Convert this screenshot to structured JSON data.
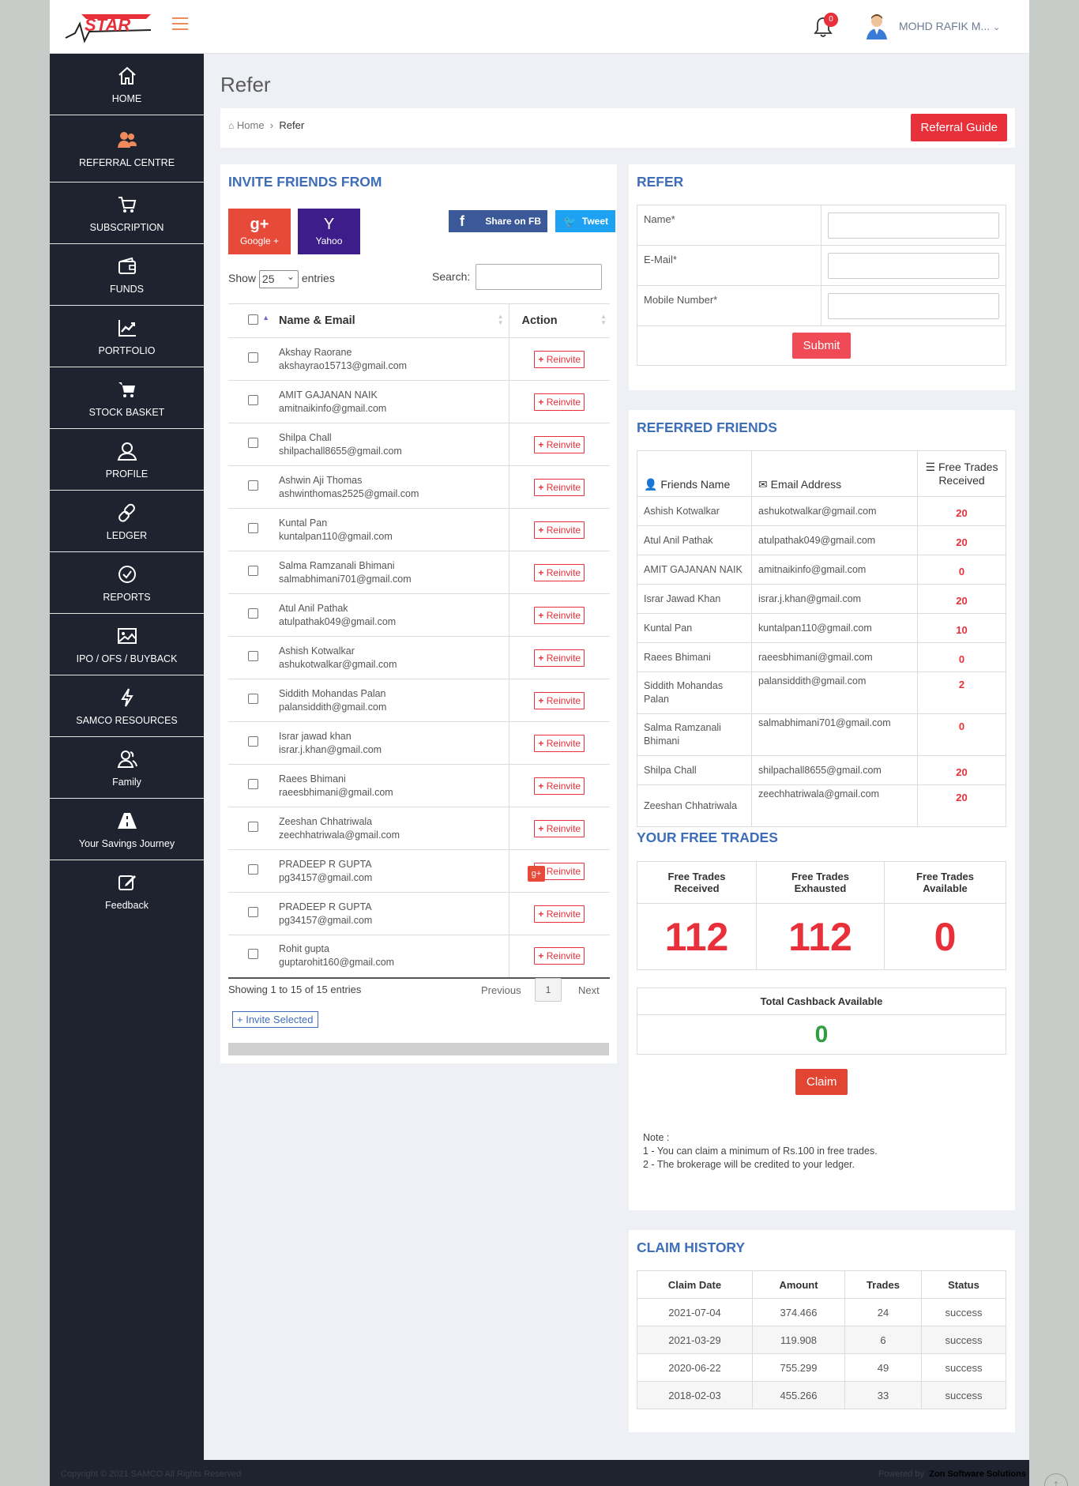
{
  "header": {
    "user_name": "MOHD RAFIK M...",
    "notification_count": "0",
    "logo_text": "STAR"
  },
  "sidebar": {
    "items": [
      {
        "label": "HOME",
        "icon": "home-icon"
      },
      {
        "label": "REFERRAL CENTRE",
        "icon": "referral-icon"
      },
      {
        "label": "SUBSCRIPTION",
        "icon": "cart-icon"
      },
      {
        "label": "FUNDS",
        "icon": "wallet-icon"
      },
      {
        "label": "PORTFOLIO",
        "icon": "chart-line-icon"
      },
      {
        "label": "STOCK BASKET",
        "icon": "basket-icon"
      },
      {
        "label": "PROFILE",
        "icon": "user-icon"
      },
      {
        "label": "LEDGER",
        "icon": "link-icon"
      },
      {
        "label": "REPORTS",
        "icon": "check-circle-icon"
      },
      {
        "label": "IPO / OFS / BUYBACK",
        "icon": "image-icon"
      },
      {
        "label": "SAMCO RESOURCES",
        "icon": "bolt-icon"
      },
      {
        "label": "Family",
        "icon": "users-icon"
      },
      {
        "label": "Your Savings Journey",
        "icon": "road-icon"
      },
      {
        "label": "Feedback",
        "icon": "edit-icon"
      }
    ]
  },
  "page": {
    "title": "Refer",
    "breadcrumb_home": "Home",
    "breadcrumb_current": "Refer",
    "guide_button": "Referral Guide"
  },
  "invite": {
    "title": "INVITE FRIENDS FROM",
    "google_label": "Google +",
    "yahoo_label": "Yahoo",
    "fb_label": "Share on FB",
    "tweet_label": "Tweet",
    "show_label": "Show",
    "entries_value": "25",
    "entries_label": "entries",
    "search_label": "Search:",
    "col_name": "Name & Email",
    "col_action": "Action",
    "reinvite_label": "Reinvite",
    "rows": [
      {
        "name": "Akshay Raorane",
        "email": "akshayrao15713@gmail.com"
      },
      {
        "name": "AMIT GAJANAN NAIK",
        "email": "amitnaikinfo@gmail.com"
      },
      {
        "name": "Shilpa Chall",
        "email": "shilpachall8655@gmail.com"
      },
      {
        "name": "Ashwin Aji Thomas",
        "email": "ashwinthomas2525@gmail.com"
      },
      {
        "name": "Kuntal Pan",
        "email": "kuntalpan110@gmail.com"
      },
      {
        "name": "Salma Ramzanali Bhimani",
        "email": "salmabhimani701@gmail.com"
      },
      {
        "name": "Atul Anil Pathak",
        "email": "atulpathak049@gmail.com"
      },
      {
        "name": "Ashish Kotwalkar",
        "email": "ashukotwalkar@gmail.com"
      },
      {
        "name": "Siddith Mohandas Palan",
        "email": "palansiddith@gmail.com"
      },
      {
        "name": "Israr jawad khan",
        "email": "israr.j.khan@gmail.com"
      },
      {
        "name": "Raees Bhimani",
        "email": "raeesbhimani@gmail.com"
      },
      {
        "name": "Zeeshan Chhatriwala",
        "email": "zeechhatriwala@gmail.com"
      },
      {
        "name": "PRADEEP R GUPTA",
        "email": "pg34157@gmail.com"
      },
      {
        "name": "PRADEEP R GUPTA",
        "email": "pg34157@gmail.com"
      },
      {
        "name": "Rohit gupta",
        "email": "guptarohit160@gmail.com"
      }
    ],
    "showing_text": "Showing 1 to 15 of 15 entries",
    "prev_label": "Previous",
    "page_num": "1",
    "next_label": "Next",
    "invite_selected": "Invite Selected"
  },
  "refer": {
    "title": "REFER",
    "name_label": "Name*",
    "email_label": "E-Mail*",
    "mobile_label": "Mobile Number*",
    "submit_label": "Submit"
  },
  "referred": {
    "title": "REFERRED FRIENDS",
    "col_name": "Friends Name",
    "col_email": "Email Address",
    "col_trades": "Free Trades Received",
    "rows": [
      {
        "name": "Ashish Kotwalkar",
        "email": "ashukotwalkar@gmail.com",
        "trades": "20"
      },
      {
        "name": "Atul Anil Pathak",
        "email": "atulpathak049@gmail.com",
        "trades": "20"
      },
      {
        "name": "AMIT GAJANAN NAIK",
        "email": "amitnaikinfo@gmail.com",
        "trades": "0"
      },
      {
        "name": "Israr Jawad Khan",
        "email": "israr.j.khan@gmail.com",
        "trades": "20"
      },
      {
        "name": "Kuntal Pan",
        "email": "kuntalpan110@gmail.com",
        "trades": "10"
      },
      {
        "name": "Raees Bhimani",
        "email": "raeesbhimani@gmail.com",
        "trades": "0"
      },
      {
        "name": "Siddith Mohandas Palan",
        "email": "palansiddith@gmail.com",
        "trades": "2"
      },
      {
        "name": "Salma Ramzanali Bhimani",
        "email": "salmabhimani701@gmail.com",
        "trades": "0"
      },
      {
        "name": "Shilpa Chall",
        "email": "shilpachall8655@gmail.com",
        "trades": "20"
      },
      {
        "name": "Zeeshan Chhatriwala",
        "email": "zeechhatriwala@gmail.com",
        "trades": "20"
      }
    ]
  },
  "free_trades": {
    "title": "YOUR FREE TRADES",
    "received_label": "Free Trades Received",
    "exhausted_label": "Free Trades Exhausted",
    "available_label": "Free Trades Available",
    "received": "112",
    "exhausted": "112",
    "available": "0",
    "cashback_label": "Total Cashback Available",
    "cashback": "0",
    "claim_label": "Claim",
    "note_title": "Note :",
    "note_1": "1 - You can claim a minimum of Rs.100 in free trades.",
    "note_2": "2 - The brokerage will be credited to your ledger."
  },
  "claim_history": {
    "title": "CLAIM HISTORY",
    "col_date": "Claim Date",
    "col_amount": "Amount",
    "col_trades": "Trades",
    "col_status": "Status",
    "rows": [
      {
        "date": "2021-07-04",
        "amount": "374.466",
        "trades": "24",
        "status": "success"
      },
      {
        "date": "2021-03-29",
        "amount": "119.908",
        "trades": "6",
        "status": "success"
      },
      {
        "date": "2020-06-22",
        "amount": "755.299",
        "trades": "49",
        "status": "success"
      },
      {
        "date": "2018-02-03",
        "amount": "455.266",
        "trades": "33",
        "status": "success"
      }
    ]
  },
  "footer": {
    "copyright": "Copyright © 2021 SAMCO All Rights Reserved",
    "powered_by": "Powered by",
    "company": "Zon Software Solutions"
  },
  "colors": {
    "accent_red": "#e8303a",
    "title_blue": "#3f6eb8",
    "sidebar_bg": "#1f2330",
    "google": "#e84a3a",
    "yahoo": "#3d1d8a",
    "facebook": "#3b5998",
    "twitter": "#1da1f2",
    "success_green": "#2e9e3e"
  }
}
